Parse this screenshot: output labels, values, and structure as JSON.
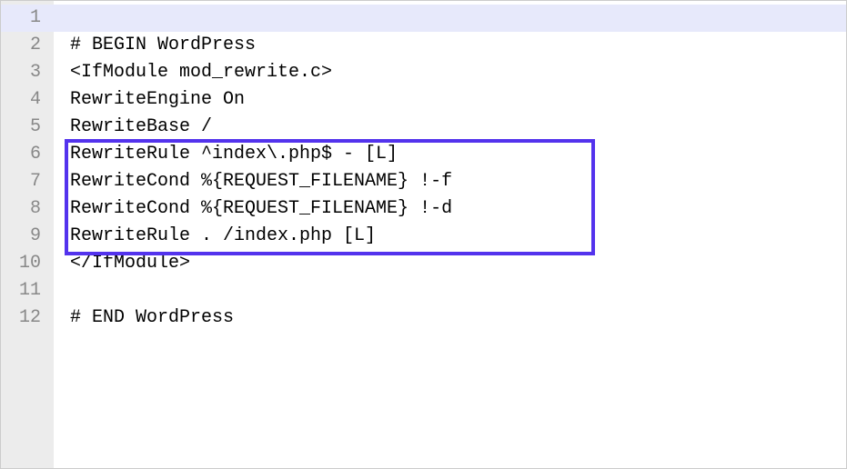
{
  "lines": [
    "",
    "# BEGIN WordPress",
    "<IfModule mod_rewrite.c>",
    "RewriteEngine On",
    "RewriteBase /",
    "RewriteRule ^index\\.php$ - [L]",
    "RewriteCond %{REQUEST_FILENAME} !-f",
    "RewriteCond %{REQUEST_FILENAME} !-d",
    "RewriteRule . /index.php [L]",
    "</IfModule>",
    "",
    "# END WordPress"
  ],
  "lineNumbers": [
    "1",
    "2",
    "3",
    "4",
    "5",
    "6",
    "7",
    "8",
    "9",
    "10",
    "11",
    "12"
  ]
}
